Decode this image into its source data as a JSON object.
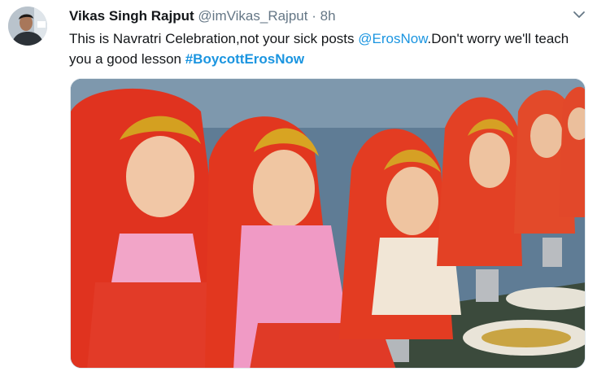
{
  "tweet": {
    "author_name": "Vikas Singh Rajput",
    "handle": "@imVikas_Rajput",
    "separator": "·",
    "time": "8h",
    "text_part1": "This is Navratri Celebration,not your sick posts ",
    "mention": "@ErosNow",
    "text_part2": ".Don't worry we'll teach you a good lesson ",
    "hashtag": "#BoycottErosNow"
  },
  "icons": {
    "menu": "chevron-down-icon",
    "avatar": "profile-avatar"
  },
  "media": {
    "description_icon": "photo"
  },
  "colors": {
    "link": "#1b95e0",
    "secondary_text": "#657786",
    "primary_text": "#14171a"
  }
}
